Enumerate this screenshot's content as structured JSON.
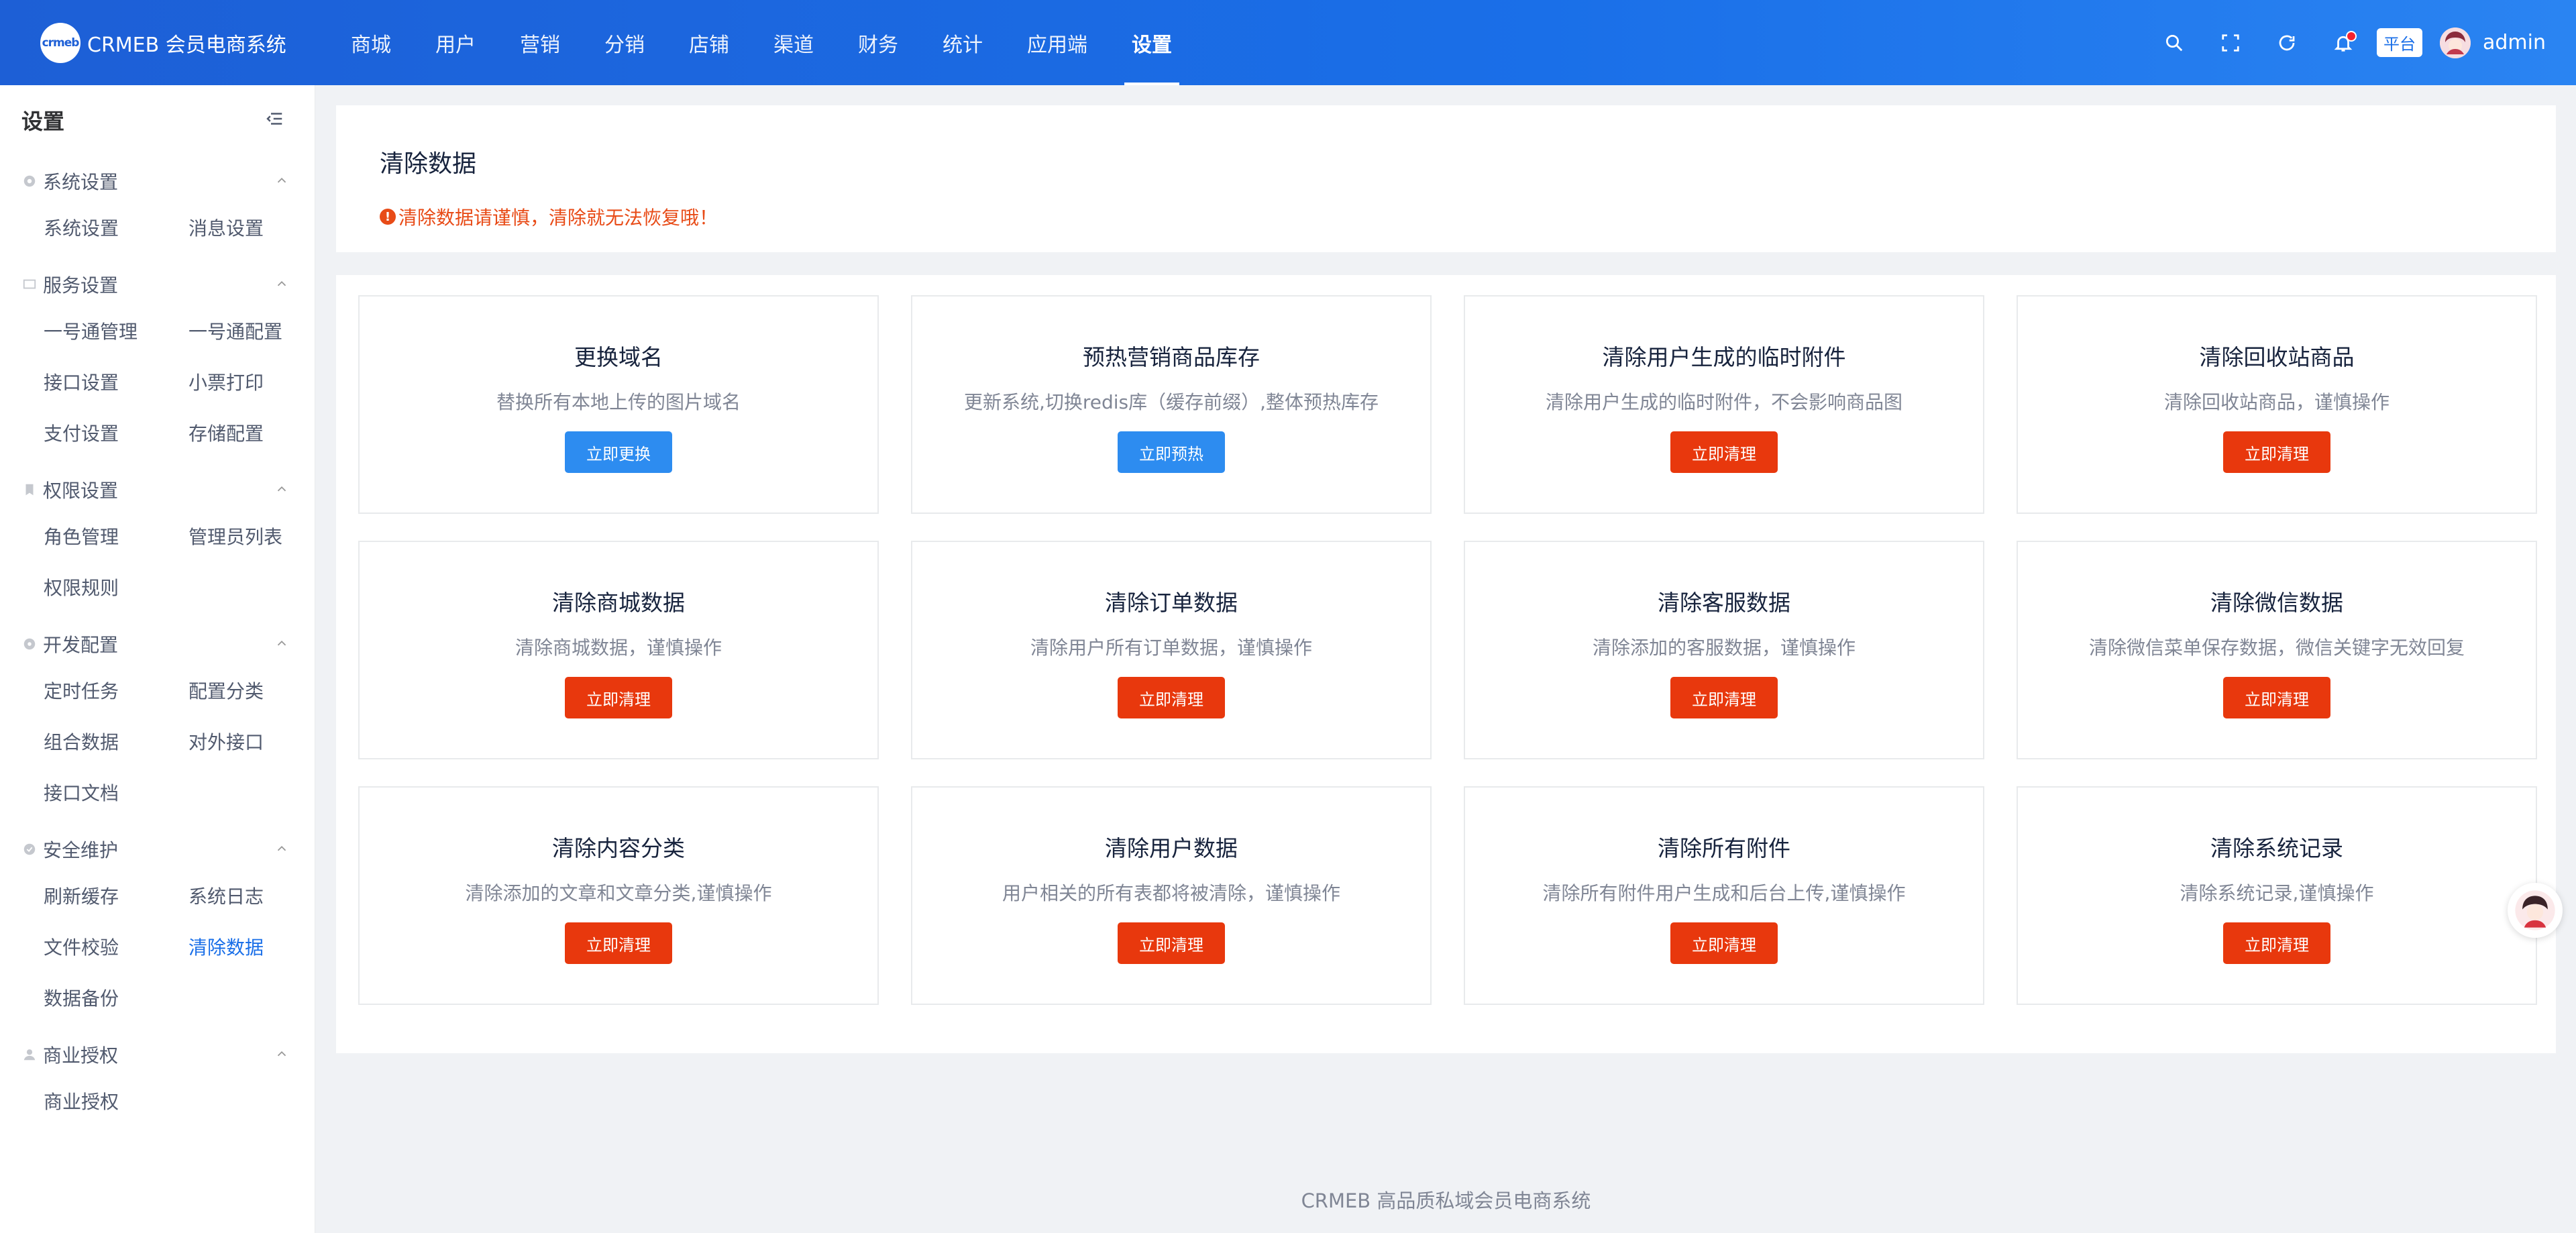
{
  "header": {
    "logo_mark": "crmeb",
    "logo_text": "CRMEB 会员电商系统",
    "nav": [
      {
        "label": "商城"
      },
      {
        "label": "用户"
      },
      {
        "label": "营销"
      },
      {
        "label": "分销"
      },
      {
        "label": "店铺"
      },
      {
        "label": "渠道"
      },
      {
        "label": "财务"
      },
      {
        "label": "统计"
      },
      {
        "label": "应用端"
      },
      {
        "label": "设置",
        "active": true
      }
    ],
    "platform_tag": "平台",
    "username": "admin",
    "icons": [
      "search-icon",
      "fullscreen-icon",
      "refresh-icon",
      "bell-icon"
    ],
    "brand_color": "#1a6fe8"
  },
  "sidebar": {
    "title": "设置",
    "groups": [
      {
        "label": "系统设置",
        "icon": "gear-icon",
        "items": [
          "系统设置",
          "消息设置"
        ]
      },
      {
        "label": "服务设置",
        "icon": "monitor-icon",
        "items": [
          "一号通管理",
          "一号通配置",
          "接口设置",
          "小票打印",
          "支付设置",
          "存储配置"
        ]
      },
      {
        "label": "权限设置",
        "icon": "bookmark-icon",
        "items": [
          "角色管理",
          "管理员列表",
          "权限规则"
        ]
      },
      {
        "label": "开发配置",
        "icon": "cog-icon",
        "items": [
          "定时任务",
          "配置分类",
          "组合数据",
          "对外接口",
          "接口文档"
        ]
      },
      {
        "label": "安全维护",
        "icon": "check-circle-icon",
        "items": [
          "刷新缓存",
          "系统日志",
          "文件校验",
          "清除数据",
          "数据备份"
        ]
      },
      {
        "label": "商业授权",
        "icon": "user-icon",
        "items": [
          "商业授权"
        ]
      }
    ],
    "active_item": "清除数据"
  },
  "main": {
    "title": "清除数据",
    "warning": "清除数据请谨慎，清除就无法恢复哦！",
    "cards": [
      {
        "title": "更换域名",
        "desc": "替换所有本地上传的图片域名",
        "button": "立即更换",
        "color": "#2d8cf0"
      },
      {
        "title": "预热营销商品库存",
        "desc": "更新系统,切换redis库（缓存前缀）,整体预热库存",
        "button": "立即预热",
        "color": "#2d8cf0"
      },
      {
        "title": "清除用户生成的临时附件",
        "desc": "清除用户生成的临时附件，不会影响商品图",
        "button": "立即清理",
        "color": "#e8380d"
      },
      {
        "title": "清除回收站商品",
        "desc": "清除回收站商品，谨慎操作",
        "button": "立即清理",
        "color": "#e8380d"
      },
      {
        "title": "清除商城数据",
        "desc": "清除商城数据，谨慎操作",
        "button": "立即清理",
        "color": "#e8380d"
      },
      {
        "title": "清除订单数据",
        "desc": "清除用户所有订单数据，谨慎操作",
        "button": "立即清理",
        "color": "#e8380d"
      },
      {
        "title": "清除客服数据",
        "desc": "清除添加的客服数据，谨慎操作",
        "button": "立即清理",
        "color": "#e8380d"
      },
      {
        "title": "清除微信数据",
        "desc": "清除微信菜单保存数据，微信关键字无效回复",
        "button": "立即清理",
        "color": "#e8380d"
      },
      {
        "title": "清除内容分类",
        "desc": "清除添加的文章和文章分类,谨慎操作",
        "button": "立即清理",
        "color": "#e8380d"
      },
      {
        "title": "清除用户数据",
        "desc": "用户相关的所有表都将被清除，谨慎操作",
        "button": "立即清理",
        "color": "#e8380d"
      },
      {
        "title": "清除所有附件",
        "desc": "清除所有附件用户生成和后台上传,谨慎操作",
        "button": "立即清理",
        "color": "#e8380d"
      },
      {
        "title": "清除系统记录",
        "desc": "清除系统记录,谨慎操作",
        "button": "立即清理",
        "color": "#e8380d"
      }
    ]
  },
  "footer": {
    "text": "CRMEB 高品质私域会员电商系统"
  }
}
